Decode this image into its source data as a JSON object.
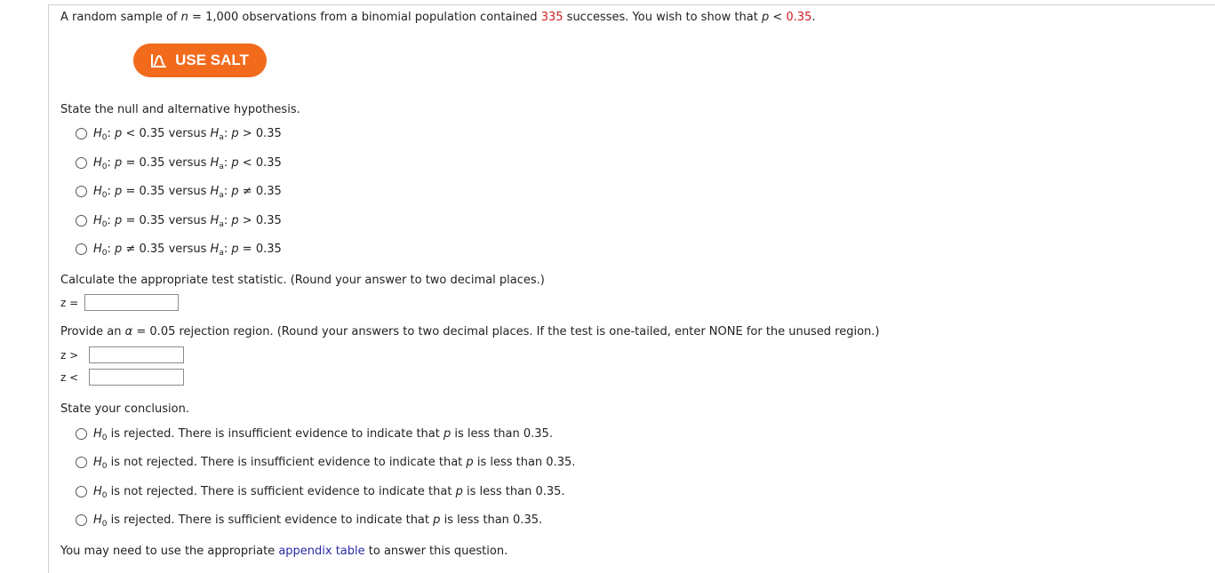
{
  "problem": {
    "pre": "A random sample of",
    "n_var": "n",
    "n_eq": "= 1,000 observations from a binomial population contained",
    "successes": "335",
    "mid": "successes. You wish to show that",
    "p_var": "p",
    "lt": "<",
    "p_value": "0.35",
    "end": "."
  },
  "salt_button": {
    "label": "USE SALT"
  },
  "hypothesis": {
    "prompt": "State the null and alternative hypothesis.",
    "options": [
      {
        "h0_rel": "<",
        "ha_rel": ">"
      },
      {
        "h0_rel": "=",
        "ha_rel": "<"
      },
      {
        "h0_rel": "=",
        "ha_rel": "≠"
      },
      {
        "h0_rel": "=",
        "ha_rel": ">"
      },
      {
        "h0_rel": "≠",
        "ha_rel": "="
      }
    ],
    "h": "H",
    "sub0": "0",
    "suba": "a",
    "p": "p",
    "value": "0.35",
    "versus": "versus"
  },
  "test_stat": {
    "prompt": "Calculate the appropriate test statistic. (Round your answer to two decimal places.)",
    "label": "z =",
    "value": ""
  },
  "rejection": {
    "pre": "Provide an",
    "alpha": "α",
    "post": "= 0.05 rejection region. (Round your answers to two decimal places. If the test is one-tailed, enter NONE for the unused region.)",
    "upper_label": "z >",
    "lower_label": "z <",
    "upper_value": "",
    "lower_value": ""
  },
  "conclusion": {
    "prompt": "State your conclusion.",
    "h": "H",
    "sub0": "0",
    "p": "p",
    "options": [
      {
        "pre": "is rejected. There is insufficient evidence to indicate that",
        "post": "is less than 0.35."
      },
      {
        "pre": "is not rejected. There is insufficient evidence to indicate that",
        "post": "is less than 0.35."
      },
      {
        "pre": "is not rejected. There is sufficient evidence to indicate that",
        "post": "is less than 0.35."
      },
      {
        "pre": "is rejected. There is sufficient evidence to indicate that",
        "post": "is less than 0.35."
      }
    ]
  },
  "footer": {
    "pre": "You may need to use the appropriate",
    "link": "appendix table",
    "post": "to answer this question."
  }
}
